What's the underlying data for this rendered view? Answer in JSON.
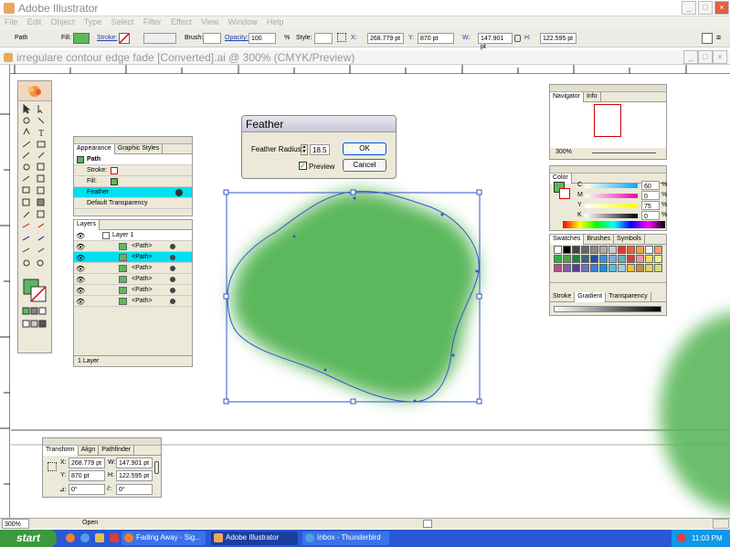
{
  "app": {
    "title": "Adobe Illustrator",
    "window_controls": [
      "_",
      "□",
      "×"
    ]
  },
  "menu": [
    "File",
    "Edit",
    "Object",
    "Type",
    "Select",
    "Filter",
    "Effect",
    "View",
    "Window",
    "Help"
  ],
  "control_bar": {
    "object_type": "Path",
    "fill_label": "Fill:",
    "stroke_label": "Stroke:",
    "brush_label": "Brush:",
    "opacity_label": "Opacity:",
    "opacity_value": "100",
    "opacity_unit": "%",
    "style_label": "Style:",
    "x_label": "X:",
    "x_value": "268.779 pt",
    "y_label": "Y:",
    "y_value": "870 pt",
    "w_label": "W:",
    "w_value": "147.901 pt",
    "h_label": "H:",
    "h_value": "122.595 pt"
  },
  "document": {
    "title": "irregulare contour edge fade  [Converted].ai @ 300% (CMYK/Preview)"
  },
  "feather_dialog": {
    "title": "Feather",
    "radius_label": "Feather Radius:",
    "radius_value": "18.5",
    "ok_label": "OK",
    "cancel_label": "Cancel",
    "preview_label": "Preview",
    "preview_checked": true
  },
  "appearance_panel": {
    "tabs": [
      "Appearance",
      "Graphic Styles"
    ],
    "object": "Path",
    "rows": [
      "Stroke:",
      "Fill:",
      "Feather",
      "Default Transparency"
    ],
    "selected_row": "Feather"
  },
  "layers_panel": {
    "tab": "Layers",
    "layer_name": "Layer 1",
    "items": [
      "<Path>",
      "<Path>",
      "<Path>",
      "<Path>",
      "<Path>",
      "<Path>"
    ],
    "selected_index": 1,
    "footer": "1 Layer"
  },
  "navigator_panel": {
    "tabs": [
      "Navigator",
      "Info"
    ],
    "zoom": "300%"
  },
  "color_panel": {
    "tab": "Color",
    "channels": [
      {
        "label": "C",
        "value": "60"
      },
      {
        "label": "M",
        "value": "0"
      },
      {
        "label": "Y",
        "value": "75"
      },
      {
        "label": "K",
        "value": "0"
      }
    ],
    "unit": "%"
  },
  "swatches_panel": {
    "tabs": [
      "Swatches",
      "Brushes",
      "Symbols"
    ],
    "swatch_colors": [
      "#ffffff",
      "#000000",
      "#444444",
      "#666666",
      "#888888",
      "#aaaaaa",
      "#cccccc",
      "#ee3333",
      "#f06030",
      "#f8a040",
      "#f0f0f0",
      "#f4a070",
      "#30b040",
      "#4fa04a",
      "#208040",
      "#406080",
      "#2050a0",
      "#4090d0",
      "#70b0e0",
      "#60b0c0",
      "#d04040",
      "#f090a0",
      "#f0e050",
      "#f0f090",
      "#b05090",
      "#8060a0",
      "#5040a0",
      "#7070c0",
      "#4080d0",
      "#2090d0",
      "#50c0e0",
      "#a0d0e0",
      "#f0c030",
      "#c09040",
      "#e0d060",
      "#d0e080"
    ]
  },
  "gradient_panel": {
    "tabs": [
      "Stroke",
      "Gradient",
      "Transparency"
    ]
  },
  "transform_panel": {
    "tabs": [
      "Transform",
      "Align",
      "Pathfinder"
    ],
    "x_label": "X:",
    "x_value": "268.779 pt",
    "y_label": "Y:",
    "y_value": "870 pt",
    "w_label": "W:",
    "w_value": "147.901 pt",
    "h_label": "H:",
    "h_value": "122.595 pt",
    "rotate_value": "0°",
    "shear_value": "0°"
  },
  "status_bar": {
    "zoom": "300%",
    "status": "Open"
  },
  "taskbar": {
    "start_label": "start",
    "tasks": [
      {
        "label": "Fading Away - Sig...",
        "active": false
      },
      {
        "label": "Adobe Illustrator",
        "active": true
      },
      {
        "label": "Inbox - Thunderbird",
        "active": false
      }
    ],
    "time": "11:03 PM"
  },
  "colors": {
    "fill_green": "#5cb85c",
    "selection_blue": "#3355cc",
    "highlight_cyan": "#00e0f0",
    "taskbar_blue": "#2a58d4"
  }
}
